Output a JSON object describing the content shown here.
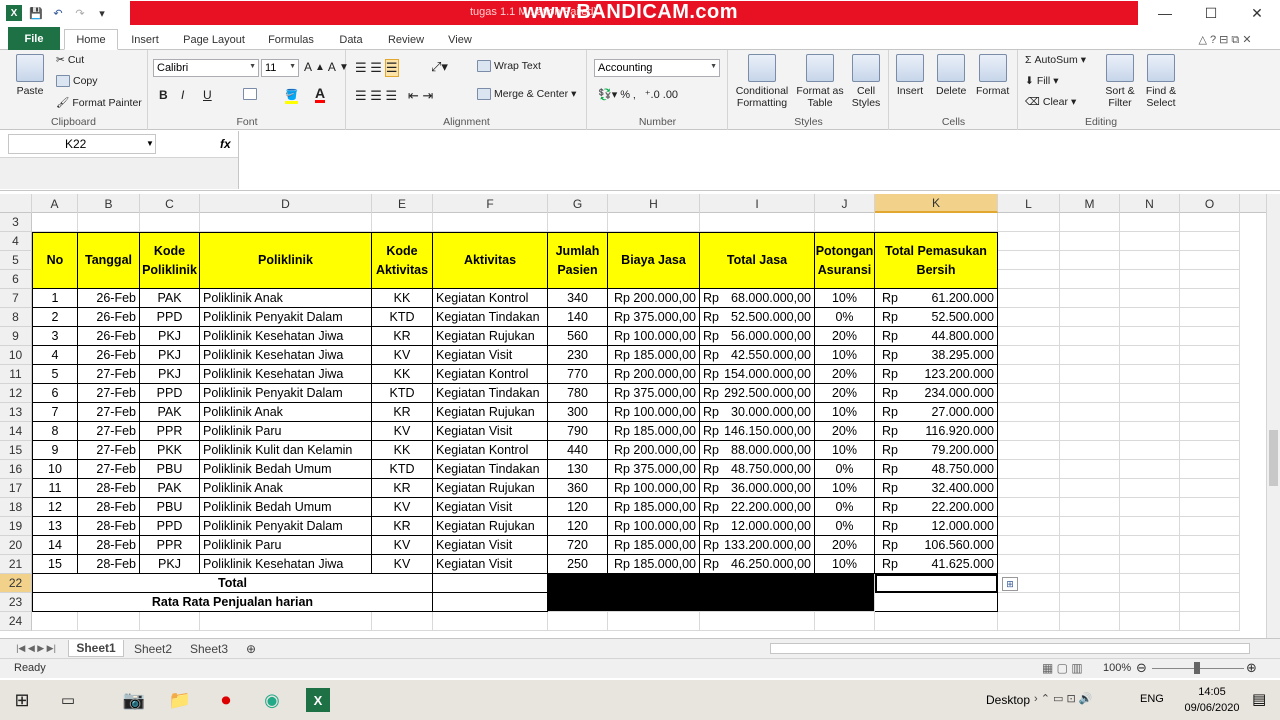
{
  "title": {
    "text": "tugas 1.1 M...ation Failed)",
    "watermark": "www.BANDICAM.com"
  },
  "tabs": [
    "File",
    "Home",
    "Insert",
    "Page Layout",
    "Formulas",
    "Data",
    "Review",
    "View"
  ],
  "ribbon": {
    "clipboard": {
      "paste": "Paste",
      "cut": "Cut",
      "copy": "Copy",
      "format_painter": "Format Painter",
      "label": "Clipboard"
    },
    "font": {
      "name": "Calibri",
      "size": "11",
      "label": "Font",
      "bold": "B",
      "italic": "I",
      "underline": "U"
    },
    "alignment": {
      "wrap": "Wrap Text",
      "merge": "Merge & Center",
      "label": "Alignment"
    },
    "number": {
      "format": "Accounting",
      "label": "Number"
    },
    "styles": {
      "conditional": "Conditional Formatting",
      "table": "Format as Table",
      "cell": "Cell Styles",
      "label": "Styles"
    },
    "cells": {
      "insert": "Insert",
      "delete": "Delete",
      "format": "Format",
      "label": "Cells"
    },
    "editing": {
      "autosum": "AutoSum",
      "fill": "Fill",
      "clear": "Clear",
      "sort": "Sort & Filter",
      "find": "Find & Select",
      "label": "Editing"
    }
  },
  "formula_bar": {
    "name_box": "K22",
    "fx": "fx",
    "value": ""
  },
  "columns": [
    "A",
    "B",
    "C",
    "D",
    "E",
    "F",
    "G",
    "H",
    "I",
    "J",
    "K",
    "L",
    "M",
    "N",
    "O"
  ],
  "headers": {
    "no": "No",
    "tanggal": "Tanggal",
    "kode_poli": "Kode Poliklinik",
    "poli": "Poliklinik",
    "kode_akt": "Kode Aktivitas",
    "aktivitas": "Aktivitas",
    "jumlah": "Jumlah Pasien",
    "biaya": "Biaya Jasa",
    "total": "Total Jasa",
    "potongan": "Potongan Asuransi",
    "bersih": "Total Pemasukan Bersih"
  },
  "rows": [
    [
      "1",
      "26-Feb",
      "PAK",
      "Poliklinik Anak",
      "KK",
      "Kegiatan Kontrol",
      "340",
      "Rp 200.000,00",
      "Rp",
      "68.000.000,00",
      "10%",
      "Rp",
      "61.200.000"
    ],
    [
      "2",
      "26-Feb",
      "PPD",
      "Poliklinik Penyakit Dalam",
      "KTD",
      "Kegiatan Tindakan",
      "140",
      "Rp 375.000,00",
      "Rp",
      "52.500.000,00",
      "0%",
      "Rp",
      "52.500.000"
    ],
    [
      "3",
      "26-Feb",
      "PKJ",
      "Poliklinik Kesehatan Jiwa",
      "KR",
      "Kegiatan Rujukan",
      "560",
      "Rp 100.000,00",
      "Rp",
      "56.000.000,00",
      "20%",
      "Rp",
      "44.800.000"
    ],
    [
      "4",
      "26-Feb",
      "PKJ",
      "Poliklinik Kesehatan Jiwa",
      "KV",
      "Kegiatan Visit",
      "230",
      "Rp 185.000,00",
      "Rp",
      "42.550.000,00",
      "10%",
      "Rp",
      "38.295.000"
    ],
    [
      "5",
      "27-Feb",
      "PKJ",
      "Poliklinik Kesehatan Jiwa",
      "KK",
      "Kegiatan Kontrol",
      "770",
      "Rp 200.000,00",
      "Rp",
      "154.000.000,00",
      "20%",
      "Rp",
      "123.200.000"
    ],
    [
      "6",
      "27-Feb",
      "PPD",
      "Poliklinik Penyakit Dalam",
      "KTD",
      "Kegiatan Tindakan",
      "780",
      "Rp 375.000,00",
      "Rp",
      "292.500.000,00",
      "20%",
      "Rp",
      "234.000.000"
    ],
    [
      "7",
      "27-Feb",
      "PAK",
      "Poliklinik Anak",
      "KR",
      "Kegiatan Rujukan",
      "300",
      "Rp 100.000,00",
      "Rp",
      "30.000.000,00",
      "10%",
      "Rp",
      "27.000.000"
    ],
    [
      "8",
      "27-Feb",
      "PPR",
      "Poliklinik Paru",
      "KV",
      "Kegiatan Visit",
      "790",
      "Rp 185.000,00",
      "Rp",
      "146.150.000,00",
      "20%",
      "Rp",
      "116.920.000"
    ],
    [
      "9",
      "27-Feb",
      "PKK",
      "Poliklinik Kulit dan Kelamin",
      "KK",
      "Kegiatan Kontrol",
      "440",
      "Rp 200.000,00",
      "Rp",
      "88.000.000,00",
      "10%",
      "Rp",
      "79.200.000"
    ],
    [
      "10",
      "27-Feb",
      "PBU",
      "Poliklinik Bedah Umum",
      "KTD",
      "Kegiatan Tindakan",
      "130",
      "Rp 375.000,00",
      "Rp",
      "48.750.000,00",
      "0%",
      "Rp",
      "48.750.000"
    ],
    [
      "11",
      "28-Feb",
      "PAK",
      "Poliklinik Anak",
      "KR",
      "Kegiatan Rujukan",
      "360",
      "Rp 100.000,00",
      "Rp",
      "36.000.000,00",
      "10%",
      "Rp",
      "32.400.000"
    ],
    [
      "12",
      "28-Feb",
      "PBU",
      "Poliklinik Bedah Umum",
      "KV",
      "Kegiatan Visit",
      "120",
      "Rp 185.000,00",
      "Rp",
      "22.200.000,00",
      "0%",
      "Rp",
      "22.200.000"
    ],
    [
      "13",
      "28-Feb",
      "PPD",
      "Poliklinik Penyakit Dalam",
      "KR",
      "Kegiatan Rujukan",
      "120",
      "Rp 100.000,00",
      "Rp",
      "12.000.000,00",
      "0%",
      "Rp",
      "12.000.000"
    ],
    [
      "14",
      "28-Feb",
      "PPR",
      "Poliklinik Paru",
      "KV",
      "Kegiatan Visit",
      "720",
      "Rp 185.000,00",
      "Rp",
      "133.200.000,00",
      "20%",
      "Rp",
      "106.560.000"
    ],
    [
      "15",
      "28-Feb",
      "PKJ",
      "Poliklinik Kesehatan Jiwa",
      "KV",
      "Kegiatan Visit",
      "250",
      "Rp 185.000,00",
      "Rp",
      "46.250.000,00",
      "10%",
      "Rp",
      "41.625.000"
    ]
  ],
  "totals": {
    "total": "Total",
    "avg": "Rata Rata Penjualan harian"
  },
  "sheets": [
    "Sheet1",
    "Sheet2",
    "Sheet3"
  ],
  "status": {
    "ready": "Ready",
    "zoom": "100%"
  },
  "taskbar": {
    "desktop": "Desktop",
    "lang": "ENG",
    "time": "14:05",
    "date": "09/06/2020"
  }
}
